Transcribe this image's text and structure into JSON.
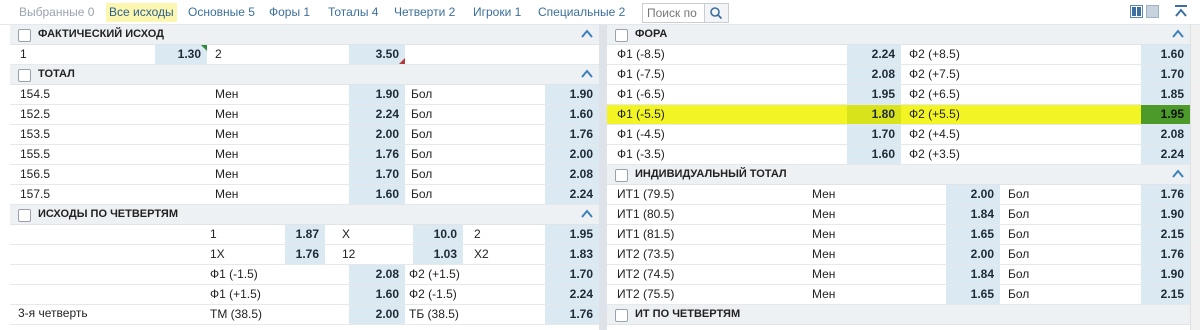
{
  "tabs": [
    {
      "label": "Выбранные 0",
      "state": "muted"
    },
    {
      "label": "Все исходы",
      "state": "active"
    },
    {
      "label": "Основные 5",
      "state": "normal"
    },
    {
      "label": "Форы 1",
      "state": "normal"
    },
    {
      "label": "Тоталы 4",
      "state": "normal"
    },
    {
      "label": "Четверти 2",
      "state": "normal"
    },
    {
      "label": "Игроки 1",
      "state": "normal"
    },
    {
      "label": "Специальные 2",
      "state": "normal"
    }
  ],
  "search": {
    "placeholder": "Поиск по"
  },
  "colors": {
    "accent": "#3c6f9c",
    "odd_bg": "#dbe9f3",
    "highlight": "#f2f523",
    "highlight_up": "#4c9a2a"
  },
  "left": {
    "actual": {
      "title": "ФАКТИЧЕСКИЙ ИСХОД",
      "rows": [
        [
          "1",
          "1.30",
          "2",
          "3.50"
        ]
      ]
    },
    "total": {
      "title": "ТОТАЛ",
      "rows": [
        [
          "154.5",
          "Мен",
          "1.90",
          "Бол",
          "1.90"
        ],
        [
          "152.5",
          "Мен",
          "2.24",
          "Бол",
          "1.60"
        ],
        [
          "153.5",
          "Мен",
          "2.00",
          "Бол",
          "1.76"
        ],
        [
          "155.5",
          "Мен",
          "1.76",
          "Бол",
          "2.00"
        ],
        [
          "156.5",
          "Мен",
          "1.70",
          "Бол",
          "2.08"
        ],
        [
          "157.5",
          "Мен",
          "1.60",
          "Бол",
          "2.24"
        ]
      ]
    },
    "quarters": {
      "title": "ИСХОДЫ ПО ЧЕТВЕРТЯМ",
      "period_label": "3-я четверть",
      "row1": [
        "1",
        "1.87",
        "X",
        "10.0",
        "2",
        "1.95"
      ],
      "row2": [
        "1X",
        "1.76",
        "12",
        "1.03",
        "X2",
        "1.83"
      ],
      "row3": [
        "Ф1 (-1.5)",
        "2.08",
        "Ф2 (+1.5)",
        "1.70"
      ],
      "row4": [
        "Ф1 (+1.5)",
        "1.60",
        "Ф2 (-1.5)",
        "2.24"
      ],
      "row5": [
        "ТМ (38.5)",
        "2.00",
        "ТБ (38.5)",
        "1.76"
      ]
    }
  },
  "right": {
    "fora": {
      "title": "ФОРА",
      "rows": [
        [
          "Ф1 (-8.5)",
          "2.24",
          "Ф2 (+8.5)",
          "1.60"
        ],
        [
          "Ф1 (-7.5)",
          "2.08",
          "Ф2 (+7.5)",
          "1.70"
        ],
        [
          "Ф1 (-6.5)",
          "1.95",
          "Ф2 (+6.5)",
          "1.85"
        ],
        [
          "Ф1 (-5.5)",
          "1.80",
          "Ф2 (+5.5)",
          "1.95"
        ],
        [
          "Ф1 (-4.5)",
          "1.70",
          "Ф2 (+4.5)",
          "2.08"
        ],
        [
          "Ф1 (-3.5)",
          "1.60",
          "Ф2 (+3.5)",
          "2.24"
        ]
      ]
    },
    "ind_total": {
      "title": "ИНДИВИДУАЛЬНЫЙ ТОТАЛ",
      "rows": [
        [
          "ИТ1 (79.5)",
          "Мен",
          "2.00",
          "Бол",
          "1.76"
        ],
        [
          "ИТ1 (80.5)",
          "Мен",
          "1.84",
          "Бол",
          "1.90"
        ],
        [
          "ИТ1 (81.5)",
          "Мен",
          "1.65",
          "Бол",
          "2.15"
        ],
        [
          "ИТ2 (73.5)",
          "Мен",
          "2.00",
          "Бол",
          "1.76"
        ],
        [
          "ИТ2 (74.5)",
          "Мен",
          "1.84",
          "Бол",
          "1.90"
        ],
        [
          "ИТ2 (75.5)",
          "Мен",
          "1.65",
          "Бол",
          "2.15"
        ]
      ]
    },
    "it_quarters": {
      "title": "ИТ ПО ЧЕТВЕРТЯМ"
    }
  }
}
